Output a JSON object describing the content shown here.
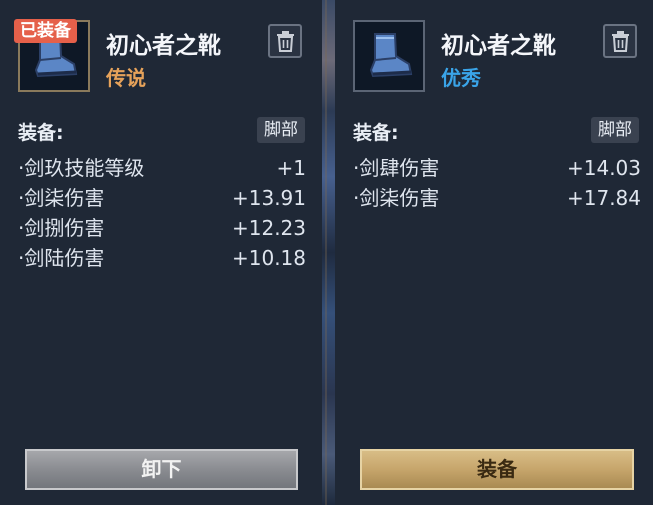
{
  "left_panel": {
    "badge": "已装备",
    "item_name": "初心者之靴",
    "rarity": "传说",
    "equip_label": "装备:",
    "slot": "脚部",
    "stats": [
      {
        "name": "·剑玖技能等级",
        "value": "+1"
      },
      {
        "name": "·剑柒伤害",
        "value": "+13.91"
      },
      {
        "name": "·剑捌伤害",
        "value": "+12.23"
      },
      {
        "name": "·剑陆伤害",
        "value": "+10.18"
      }
    ],
    "action_label": "卸下",
    "rarity_color": "#e6a25a"
  },
  "right_panel": {
    "item_name": "初心者之靴",
    "rarity": "优秀",
    "equip_label": "装备:",
    "slot": "脚部",
    "stats": [
      {
        "name": "·剑肆伤害",
        "value": "+14.03"
      },
      {
        "name": "·剑柒伤害",
        "value": "+17.84"
      }
    ],
    "action_label": "装备",
    "rarity_color": "#3aa4e8"
  },
  "icons": {
    "item": "boot-icon",
    "delete": "trash-icon"
  }
}
